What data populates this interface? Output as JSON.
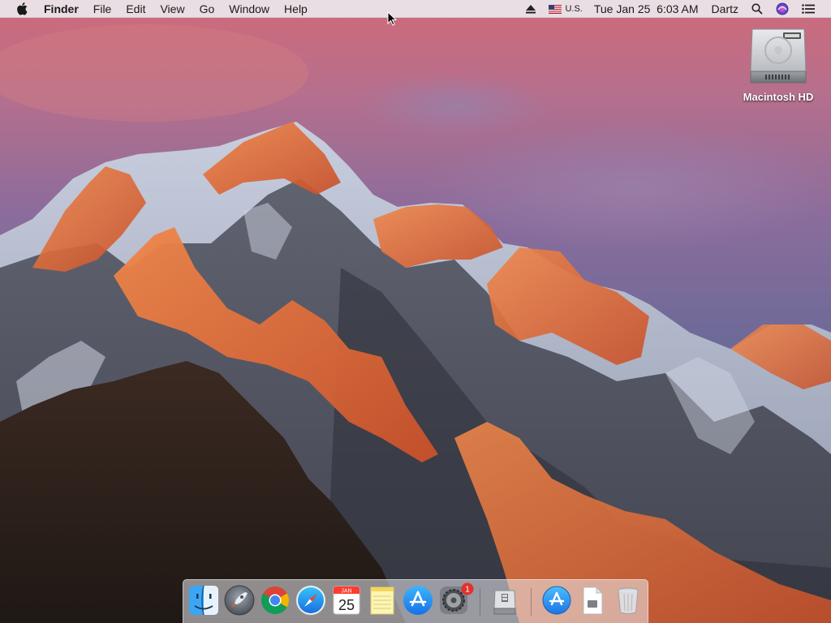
{
  "menubar": {
    "apple_icon": "apple-logo-icon",
    "app_name": "Finder",
    "menus": [
      "File",
      "Edit",
      "View",
      "Go",
      "Window",
      "Help"
    ],
    "status": {
      "eject_icon": "eject-icon",
      "input_source_flag": "us-flag-icon",
      "input_source": "U.S.",
      "datetime": "Tue Jan 25  6:03 AM",
      "user": "Dartz",
      "spotlight_icon": "magnifier-icon",
      "siri_icon": "siri-icon",
      "notification_icon": "notification-center-icon"
    }
  },
  "desktop": {
    "icons": [
      {
        "label": "Macintosh HD",
        "icon": "hard-drive-icon"
      }
    ]
  },
  "dock": {
    "apps": [
      {
        "name": "Finder",
        "icon": "finder-icon",
        "running": true
      },
      {
        "name": "Launchpad",
        "icon": "launchpad-rocket-icon",
        "running": false
      },
      {
        "name": "Google Chrome",
        "icon": "chrome-icon",
        "running": false
      },
      {
        "name": "Safari",
        "icon": "safari-compass-icon",
        "running": false
      },
      {
        "name": "Calendar",
        "icon": "calendar-icon",
        "month": "JAN",
        "day": "25",
        "running": false
      },
      {
        "name": "Notes",
        "icon": "notes-icon",
        "running": false
      },
      {
        "name": "App Store",
        "icon": "app-store-icon",
        "running": false
      },
      {
        "name": "System Preferences",
        "icon": "gear-icon",
        "badge": "1",
        "running": false
      },
      {
        "name": "Boot Camp Assistant",
        "icon": "boot-camp-disk-icon",
        "running": false
      },
      {
        "name": "Applications",
        "icon": "applications-folder-icon",
        "running": false
      },
      {
        "name": "Document",
        "icon": "document-icon",
        "running": false
      },
      {
        "name": "Trash",
        "icon": "trash-icon",
        "running": false
      }
    ]
  },
  "colors": {
    "menubar_bg": "#ece8ec",
    "sky_top": "#d06a7a",
    "sky_mid": "#7b6e9e",
    "peak_glow": "#e86a38",
    "badge_red": "#e3312b",
    "app_store_blue": "#1e8ff0"
  }
}
